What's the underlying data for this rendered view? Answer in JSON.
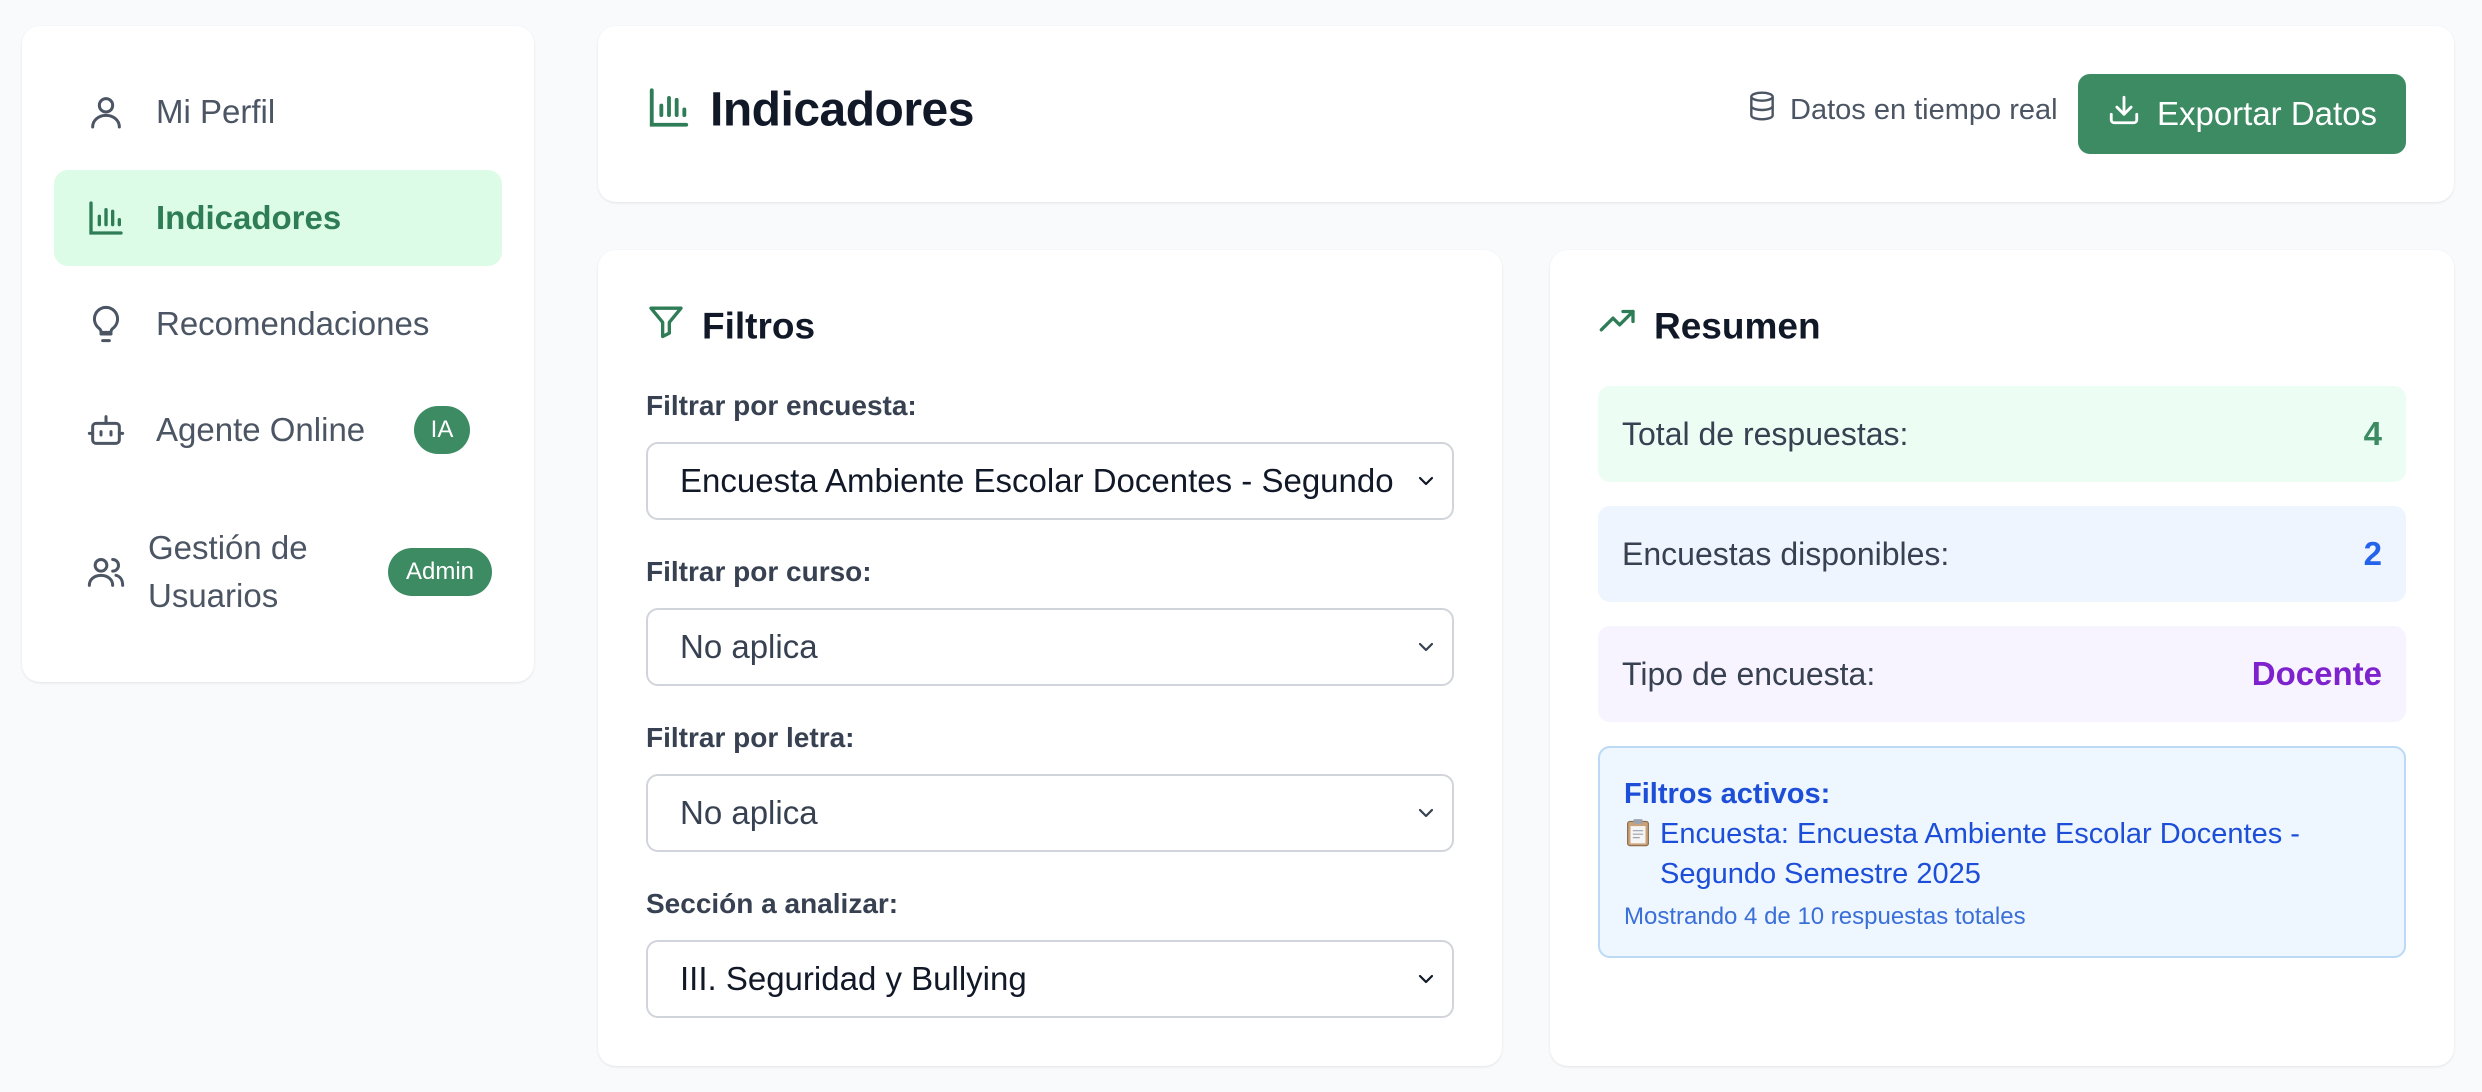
{
  "sidebar": {
    "items": [
      {
        "label": "Mi Perfil",
        "icon": "user-icon"
      },
      {
        "label": "Indicadores",
        "icon": "bar-chart-icon",
        "active": true
      },
      {
        "label": "Recomendaciones",
        "icon": "lightbulb-icon"
      },
      {
        "label": "Agente Online",
        "icon": "bot-icon",
        "badge": "IA"
      },
      {
        "label_line1": "Gestión de",
        "label_line2": "Usuarios",
        "icon": "users-icon",
        "badge": "Admin"
      }
    ]
  },
  "header": {
    "title": "Indicadores",
    "realtime_label": "Datos en tiempo real",
    "export_label": "Exportar Datos"
  },
  "filters": {
    "title": "Filtros",
    "survey_label": "Filtrar por encuesta:",
    "survey_value": "Encuesta Ambiente Escolar Docentes - Segundo Semestre 2025",
    "course_label": "Filtrar por curso:",
    "course_value": "No aplica",
    "letter_label": "Filtrar por letra:",
    "letter_value": "No aplica",
    "section_label": "Sección a analizar:",
    "section_value": "III. Seguridad y Bullying"
  },
  "summary": {
    "title": "Resumen",
    "total_label": "Total de respuestas:",
    "total_value": "4",
    "available_label": "Encuestas disponibles:",
    "available_value": "2",
    "type_label": "Tipo de encuesta:",
    "type_value": "Docente",
    "active_title": "Filtros activos:",
    "active_line": "Encuesta: Encuesta Ambiente Escolar Docentes - Segundo Semestre 2025",
    "active_footer": "Mostrando 4 de 10 respuestas totales"
  },
  "colors": {
    "accent_green": "#3d8b62",
    "active_bg": "#dcfce7",
    "blue": "#1d4ed8",
    "purple": "#7e22ce"
  }
}
